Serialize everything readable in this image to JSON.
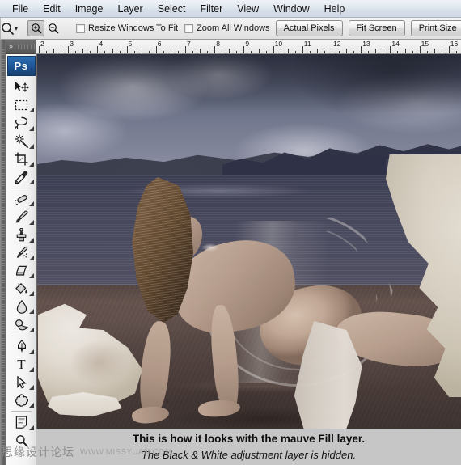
{
  "app": {
    "name": "Adobe Photoshop",
    "logo_text": "Ps"
  },
  "menubar": {
    "items": [
      {
        "label": "File"
      },
      {
        "label": "Edit"
      },
      {
        "label": "Image"
      },
      {
        "label": "Layer"
      },
      {
        "label": "Select"
      },
      {
        "label": "Filter"
      },
      {
        "label": "View"
      },
      {
        "label": "Window"
      },
      {
        "label": "Help"
      }
    ]
  },
  "options_bar": {
    "active_tool": "zoom-tool",
    "tool_preset_caret": "▾",
    "zoom_in_icon": "zoom-in-icon",
    "zoom_out_icon": "zoom-out-icon",
    "zoom_in_selected": true,
    "checkboxes": [
      {
        "label": "Resize Windows To Fit",
        "checked": false
      },
      {
        "label": "Zoom All Windows",
        "checked": false
      }
    ],
    "buttons": [
      {
        "label": "Actual Pixels"
      },
      {
        "label": "Fit Screen"
      },
      {
        "label": "Print Size"
      }
    ]
  },
  "toolbox": {
    "collapse_arrows": "»",
    "tools": [
      {
        "name": "move-tool",
        "has_flyout": false
      },
      {
        "name": "rectangular-marquee-tool",
        "has_flyout": true
      },
      {
        "name": "lasso-tool",
        "has_flyout": true
      },
      {
        "name": "magic-wand-tool",
        "has_flyout": true
      },
      {
        "name": "crop-tool",
        "has_flyout": true
      },
      {
        "name": "eyedropper-tool",
        "has_flyout": true
      },
      {
        "name": "spot-healing-brush-tool",
        "has_flyout": true
      },
      {
        "name": "brush-tool",
        "has_flyout": true
      },
      {
        "name": "clone-stamp-tool",
        "has_flyout": true
      },
      {
        "name": "history-brush-tool",
        "has_flyout": true
      },
      {
        "name": "eraser-tool",
        "has_flyout": true
      },
      {
        "name": "gradient-paint-bucket-tool",
        "has_flyout": true
      },
      {
        "name": "blur-tool",
        "has_flyout": true
      },
      {
        "name": "dodge-tool",
        "has_flyout": true
      },
      {
        "name": "pen-tool",
        "has_flyout": true
      },
      {
        "name": "type-tool",
        "has_flyout": true
      },
      {
        "name": "path-selection-tool",
        "has_flyout": true
      },
      {
        "name": "custom-shape-tool",
        "has_flyout": true
      },
      {
        "name": "notes-tool",
        "has_flyout": true
      },
      {
        "name": "zoom-tool",
        "has_flyout": false
      }
    ]
  },
  "ruler": {
    "unit": "inches",
    "labels": [
      "2",
      "3",
      "4",
      "5",
      "6",
      "7",
      "8",
      "9",
      "10",
      "11",
      "12",
      "13",
      "14",
      "15",
      "16"
    ],
    "start_value": 2,
    "end_value": 16
  },
  "canvas": {
    "document_description": "Composite photo of a woman on a dark beach emerging from a giant cracked eggshell under a stormy sky",
    "colors": {
      "sky_top": "#4c5266",
      "sky_bottom": "#8a8fa2",
      "mountain": "#3c3f4f",
      "sea": "#4a4c62",
      "sand": "#5c4c48",
      "sand_dark": "#413633",
      "eggshell": "#e6e0cf",
      "eggshell_highlight": "#f2eee0",
      "skin": "#c4ab98",
      "hair": "#7a5e42",
      "mauve_fill": "#806c80"
    }
  },
  "caption": {
    "line1": "This is how it looks with the mauve Fill layer.",
    "line2": "The Black & White adjustment layer is hidden."
  },
  "watermark": {
    "site_name_cn": "思缘设计论坛",
    "url": "WWW.MISSYUAN.COM"
  }
}
